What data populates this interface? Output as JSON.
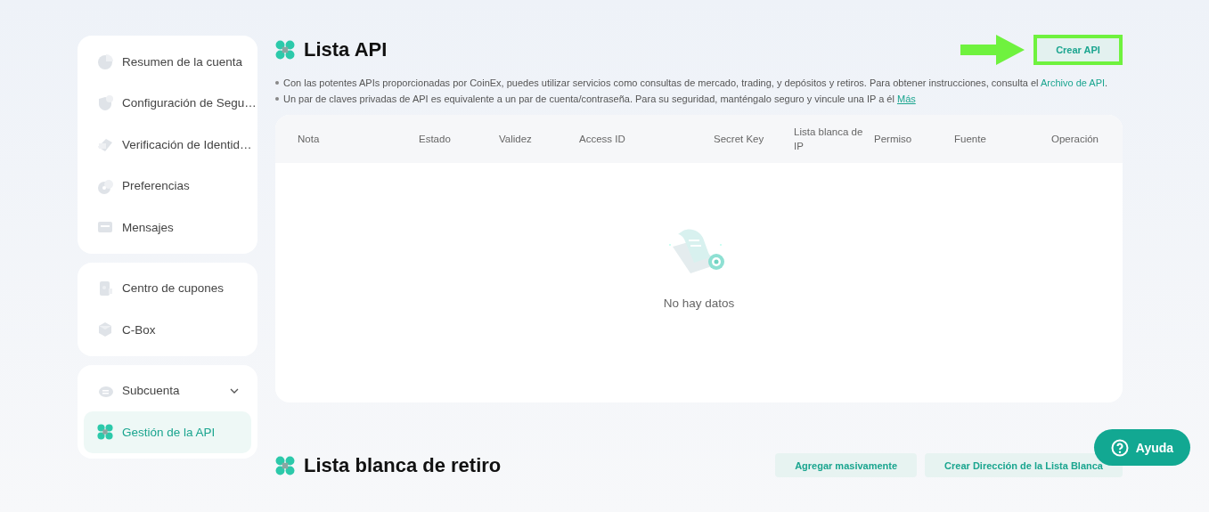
{
  "sidebar": {
    "groups": [
      {
        "items": [
          {
            "label": "Resumen de la cuenta",
            "kind": "pie",
            "selected": false
          },
          {
            "label": "Configuración de Segu…",
            "kind": "shield",
            "selected": false
          },
          {
            "label": "Verificación de Identid…",
            "kind": "card",
            "selected": false
          },
          {
            "label": "Preferencias",
            "kind": "gear",
            "selected": false
          },
          {
            "label": "Mensajes",
            "kind": "message",
            "selected": false
          }
        ]
      },
      {
        "items": [
          {
            "label": "Centro de cupones",
            "kind": "coupon",
            "selected": false
          },
          {
            "label": "C-Box",
            "kind": "box",
            "selected": false
          }
        ]
      },
      {
        "items": [
          {
            "label": "Subcuenta",
            "kind": "users",
            "selected": false,
            "expanded": false
          },
          {
            "label": "Gestión de la API",
            "kind": "api",
            "selected": true
          }
        ]
      }
    ]
  },
  "api_list": {
    "title": "Lista API",
    "create_button": {
      "label": "Crear API",
      "highlighted": true
    },
    "notes": [
      {
        "text": "Con las potentes APIs proporcionadas por CoinEx, puedes utilizar servicios como consultas de mercado, trading, y depósitos y retiros. Para obtener instrucciones, consulta el ",
        "link": "Archivo de API",
        "after": "."
      },
      {
        "text": "Un par de claves privadas de API es equivalente a un par de cuenta/contraseña. Para su seguridad, manténgalo seguro y vincule una IP a él ",
        "link": "Más"
      }
    ],
    "table": {
      "columns": [
        "Nota",
        "Estado",
        "Validez",
        "Access ID",
        "Secret Key",
        "Lista blanca de IP",
        "Permiso",
        "Fuente",
        "Operación"
      ],
      "empty_text": "No hay datos"
    }
  },
  "whitelist": {
    "title": "Lista blanca de retiro",
    "buttons": [
      "Agregar masivamente",
      "Crear Dirección de la Lista Blanca"
    ]
  },
  "help_button": {
    "label": "Ayuda"
  }
}
